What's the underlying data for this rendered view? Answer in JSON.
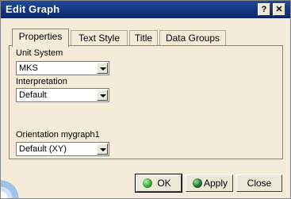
{
  "window": {
    "title": "Edit Graph",
    "help_label": "?",
    "close_label": "✕"
  },
  "tabs": [
    {
      "label": "Properties",
      "active": true
    },
    {
      "label": "Text Style",
      "active": false
    },
    {
      "label": "Title",
      "active": false
    },
    {
      "label": "Data Groups",
      "active": false
    }
  ],
  "properties": {
    "unit_system": {
      "label": "Unit System",
      "value": "MKS"
    },
    "interpretation": {
      "label": "Interpretation",
      "value": "Default"
    },
    "orientation": {
      "label": "Orientation mygraph1",
      "value": "Default (XY)"
    }
  },
  "buttons": {
    "ok": {
      "label": "OK",
      "icon": "green-circle-icon",
      "color": "#2fa53a"
    },
    "apply": {
      "label": "Apply",
      "icon": "green-circle-icon",
      "color": "#1d6f2a"
    },
    "close": {
      "label": "Close"
    }
  }
}
